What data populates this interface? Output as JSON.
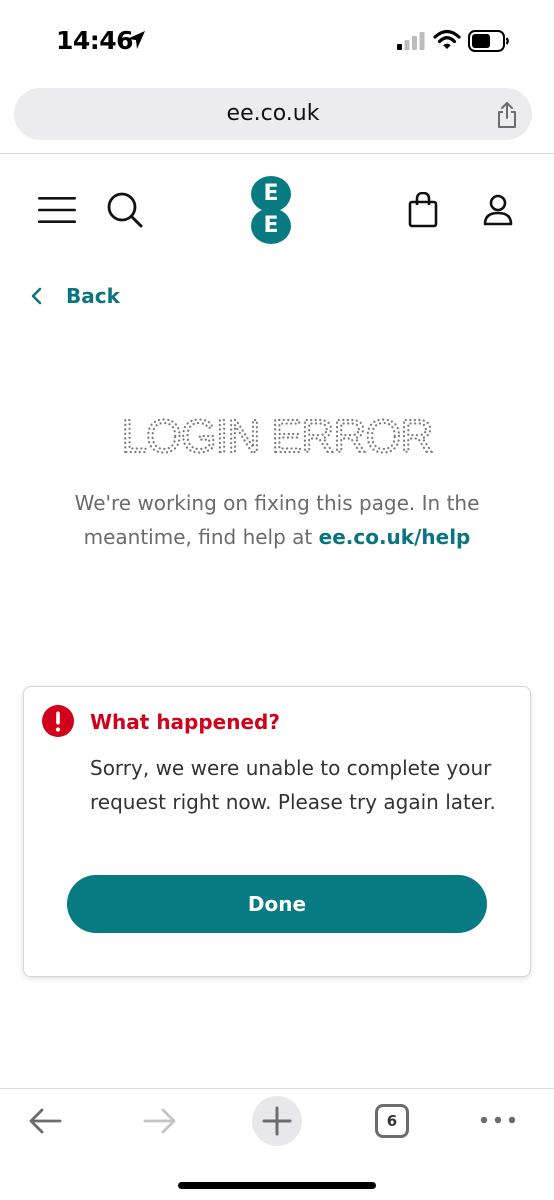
{
  "status_bar": {
    "time": "14:46"
  },
  "browser": {
    "url": "ee.co.uk",
    "tab_count": "6"
  },
  "header": {
    "logo_letters": [
      "E",
      "E"
    ]
  },
  "back_link": {
    "label": "Back"
  },
  "error": {
    "title": "LOGIN ERROR",
    "description": "We're working on fixing this page. In the meantime, find help at ",
    "help_link": "ee.co.uk/help"
  },
  "dialog": {
    "title": "What happened?",
    "body": "Sorry, we were unable to complete your request right now. Please try again later.",
    "done_label": "Done"
  },
  "colors": {
    "brand_teal": "#077a82",
    "error_red": "#d0021b"
  }
}
